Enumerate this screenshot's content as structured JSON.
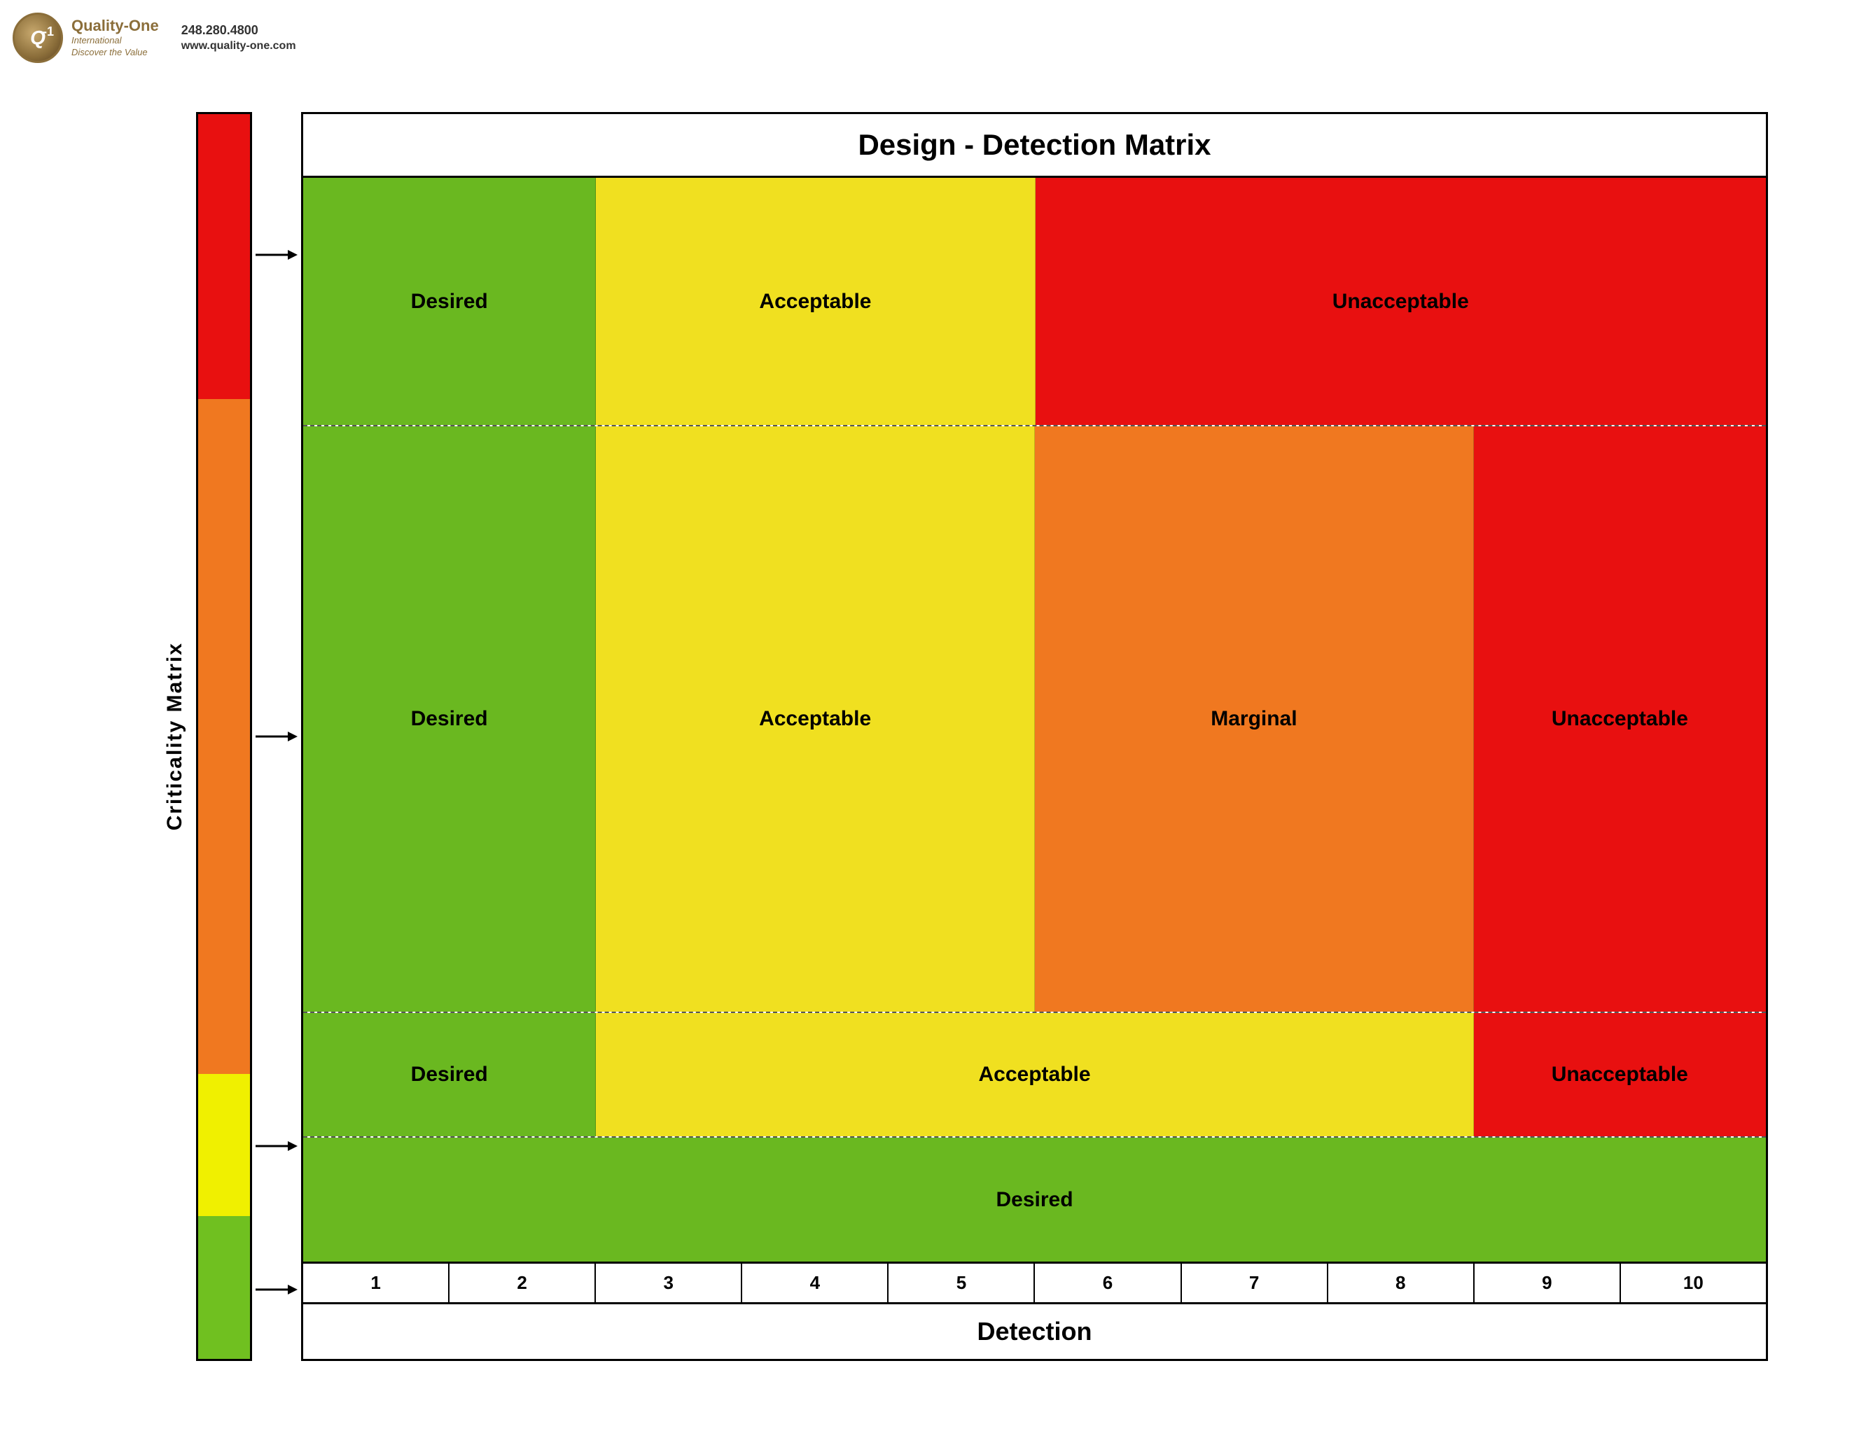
{
  "header": {
    "company": "Quality-One",
    "tagline_line1": "International",
    "tagline_line2": "Discover the Value",
    "phone": "248.280.4800",
    "website": "www.quality-one.com",
    "logo_q": "Q",
    "logo_dash": "-",
    "logo_one": "1"
  },
  "chart": {
    "title": "Design - Detection Matrix",
    "criticality_label": "Criticality Matrix",
    "detection_label": "Detection",
    "rows": [
      {
        "criticality_color": "red",
        "cells": [
          {
            "label": "Desired",
            "bg": "green",
            "span": "cols1-2"
          },
          {
            "label": "Acceptable",
            "bg": "yellow",
            "span": "cols3-5"
          },
          {
            "label": "Unacceptable",
            "bg": "red",
            "span": "cols6-10"
          }
        ]
      },
      {
        "criticality_color": "orange",
        "cells": [
          {
            "label": "Desired",
            "bg": "green",
            "span": "cols1-2"
          },
          {
            "label": "Acceptable",
            "bg": "yellow",
            "span": "cols3-5"
          },
          {
            "label": "Marginal",
            "bg": "orange",
            "span": "cols6-8"
          },
          {
            "label": "Unacceptable",
            "bg": "red",
            "span": "cols9-10"
          }
        ]
      },
      {
        "criticality_color": "yellow",
        "cells": [
          {
            "label": "Desired",
            "bg": "green",
            "span": "cols1-2"
          },
          {
            "label": "Acceptable",
            "bg": "yellow",
            "span": "cols3-8"
          },
          {
            "label": "Unacceptable",
            "bg": "red",
            "span": "cols9-10"
          }
        ]
      },
      {
        "criticality_color": "green",
        "cells": [
          {
            "label": "Desired",
            "bg": "green",
            "span": "cols1-10"
          }
        ]
      }
    ],
    "scale": [
      1,
      2,
      3,
      4,
      5,
      6,
      7,
      8,
      9,
      10
    ]
  }
}
